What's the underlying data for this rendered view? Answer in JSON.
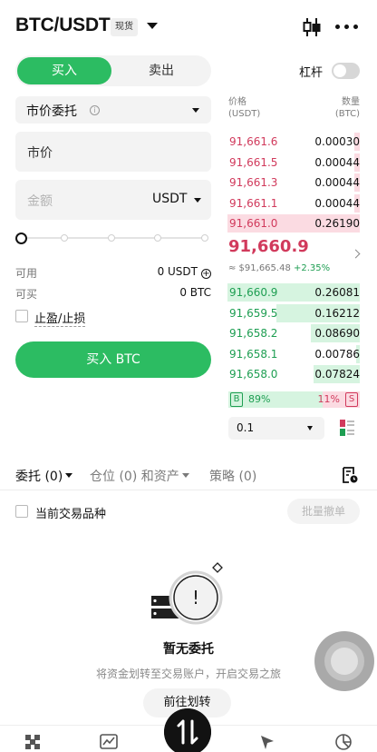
{
  "header": {
    "pair": "BTC/USDT",
    "spot_tag": "现货",
    "icons": [
      "chart-icon",
      "more-icon"
    ]
  },
  "order_form": {
    "buy_tab": "买入",
    "sell_tab": "卖出",
    "leverage_label": "杠杆",
    "leverage_enabled": false,
    "order_type": "市价委托",
    "price_value": "市价",
    "amount_placeholder": "金额",
    "amount_unit": "USDT",
    "slider_percent": 0,
    "available_label": "可用",
    "available_value": "0 USDT",
    "can_buy_label": "可买",
    "can_buy_value": "0 BTC",
    "tpsl_label": "止盈/止损",
    "buy_button": "买入 BTC"
  },
  "order_book": {
    "price_header": "价格",
    "price_unit": "(USDT)",
    "qty_header": "数量",
    "qty_unit": "(BTC)",
    "asks": [
      {
        "price": "91,661.6",
        "qty": "0.00030",
        "depth": 0.04
      },
      {
        "price": "91,661.5",
        "qty": "0.00044",
        "depth": 0.04
      },
      {
        "price": "91,661.3",
        "qty": "0.00044",
        "depth": 0.04
      },
      {
        "price": "91,661.1",
        "qty": "0.00044",
        "depth": 0.04
      },
      {
        "price": "91,661.0",
        "qty": "0.26190",
        "depth": 1.0
      }
    ],
    "last_price": "91,660.9",
    "index_price": "≈ $91,665.48",
    "change": "+2.35%",
    "bids": [
      {
        "price": "91,660.9",
        "qty": "0.26081",
        "depth": 1.0
      },
      {
        "price": "91,659.5",
        "qty": "0.16212",
        "depth": 0.63
      },
      {
        "price": "91,658.2",
        "qty": "0.08690",
        "depth": 0.37
      },
      {
        "price": "91,658.1",
        "qty": "0.00786",
        "depth": 0.03
      },
      {
        "price": "91,658.0",
        "qty": "0.07824",
        "depth": 0.35
      }
    ],
    "buy_badge": "B",
    "buy_ratio": "89%",
    "sell_ratio": "11%",
    "sell_badge": "S",
    "depth_value": "0.1"
  },
  "orders": {
    "tab_orders": "委托 (0)",
    "tab_positions": "仓位 (0) 和资产",
    "tab_strategy": "策略 (0)",
    "filter_label": "当前交易品种",
    "batch_cancel": "批量撤单",
    "empty_title": "暂无委托",
    "empty_subtitle": "将资金划转至交易账户，开启交易之旅",
    "transfer_button": "前往划转"
  },
  "colors": {
    "buy_green": "#2cbc62",
    "bid_green": "#1e9e52",
    "ask_red": "#d13a5c"
  }
}
